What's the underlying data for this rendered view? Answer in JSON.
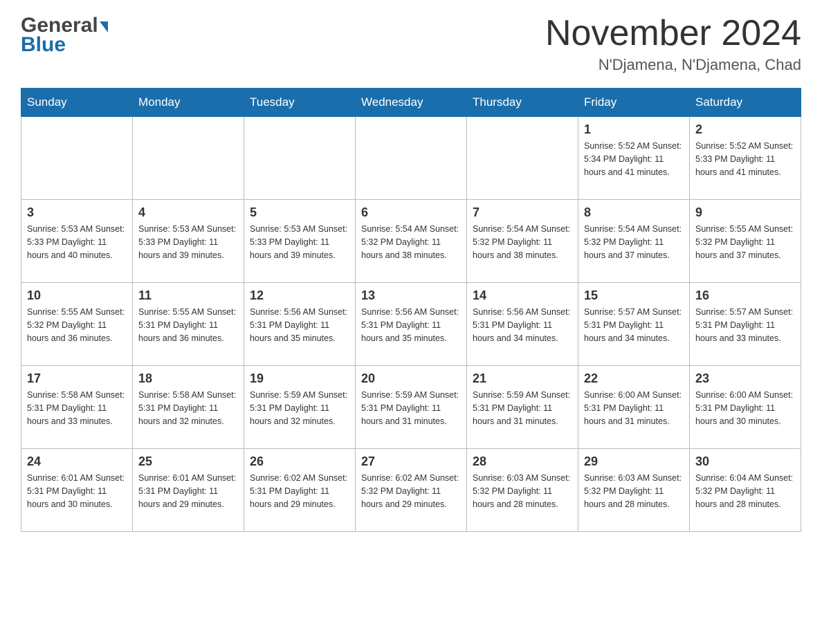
{
  "header": {
    "logo_general": "General",
    "logo_blue": "Blue",
    "month_title": "November 2024",
    "location": "N'Djamena, N'Djamena, Chad"
  },
  "calendar": {
    "days_of_week": [
      "Sunday",
      "Monday",
      "Tuesday",
      "Wednesday",
      "Thursday",
      "Friday",
      "Saturday"
    ],
    "weeks": [
      [
        {
          "day": "",
          "info": ""
        },
        {
          "day": "",
          "info": ""
        },
        {
          "day": "",
          "info": ""
        },
        {
          "day": "",
          "info": ""
        },
        {
          "day": "",
          "info": ""
        },
        {
          "day": "1",
          "info": "Sunrise: 5:52 AM\nSunset: 5:34 PM\nDaylight: 11 hours and 41 minutes."
        },
        {
          "day": "2",
          "info": "Sunrise: 5:52 AM\nSunset: 5:33 PM\nDaylight: 11 hours and 41 minutes."
        }
      ],
      [
        {
          "day": "3",
          "info": "Sunrise: 5:53 AM\nSunset: 5:33 PM\nDaylight: 11 hours and 40 minutes."
        },
        {
          "day": "4",
          "info": "Sunrise: 5:53 AM\nSunset: 5:33 PM\nDaylight: 11 hours and 39 minutes."
        },
        {
          "day": "5",
          "info": "Sunrise: 5:53 AM\nSunset: 5:33 PM\nDaylight: 11 hours and 39 minutes."
        },
        {
          "day": "6",
          "info": "Sunrise: 5:54 AM\nSunset: 5:32 PM\nDaylight: 11 hours and 38 minutes."
        },
        {
          "day": "7",
          "info": "Sunrise: 5:54 AM\nSunset: 5:32 PM\nDaylight: 11 hours and 38 minutes."
        },
        {
          "day": "8",
          "info": "Sunrise: 5:54 AM\nSunset: 5:32 PM\nDaylight: 11 hours and 37 minutes."
        },
        {
          "day": "9",
          "info": "Sunrise: 5:55 AM\nSunset: 5:32 PM\nDaylight: 11 hours and 37 minutes."
        }
      ],
      [
        {
          "day": "10",
          "info": "Sunrise: 5:55 AM\nSunset: 5:32 PM\nDaylight: 11 hours and 36 minutes."
        },
        {
          "day": "11",
          "info": "Sunrise: 5:55 AM\nSunset: 5:31 PM\nDaylight: 11 hours and 36 minutes."
        },
        {
          "day": "12",
          "info": "Sunrise: 5:56 AM\nSunset: 5:31 PM\nDaylight: 11 hours and 35 minutes."
        },
        {
          "day": "13",
          "info": "Sunrise: 5:56 AM\nSunset: 5:31 PM\nDaylight: 11 hours and 35 minutes."
        },
        {
          "day": "14",
          "info": "Sunrise: 5:56 AM\nSunset: 5:31 PM\nDaylight: 11 hours and 34 minutes."
        },
        {
          "day": "15",
          "info": "Sunrise: 5:57 AM\nSunset: 5:31 PM\nDaylight: 11 hours and 34 minutes."
        },
        {
          "day": "16",
          "info": "Sunrise: 5:57 AM\nSunset: 5:31 PM\nDaylight: 11 hours and 33 minutes."
        }
      ],
      [
        {
          "day": "17",
          "info": "Sunrise: 5:58 AM\nSunset: 5:31 PM\nDaylight: 11 hours and 33 minutes."
        },
        {
          "day": "18",
          "info": "Sunrise: 5:58 AM\nSunset: 5:31 PM\nDaylight: 11 hours and 32 minutes."
        },
        {
          "day": "19",
          "info": "Sunrise: 5:59 AM\nSunset: 5:31 PM\nDaylight: 11 hours and 32 minutes."
        },
        {
          "day": "20",
          "info": "Sunrise: 5:59 AM\nSunset: 5:31 PM\nDaylight: 11 hours and 31 minutes."
        },
        {
          "day": "21",
          "info": "Sunrise: 5:59 AM\nSunset: 5:31 PM\nDaylight: 11 hours and 31 minutes."
        },
        {
          "day": "22",
          "info": "Sunrise: 6:00 AM\nSunset: 5:31 PM\nDaylight: 11 hours and 31 minutes."
        },
        {
          "day": "23",
          "info": "Sunrise: 6:00 AM\nSunset: 5:31 PM\nDaylight: 11 hours and 30 minutes."
        }
      ],
      [
        {
          "day": "24",
          "info": "Sunrise: 6:01 AM\nSunset: 5:31 PM\nDaylight: 11 hours and 30 minutes."
        },
        {
          "day": "25",
          "info": "Sunrise: 6:01 AM\nSunset: 5:31 PM\nDaylight: 11 hours and 29 minutes."
        },
        {
          "day": "26",
          "info": "Sunrise: 6:02 AM\nSunset: 5:31 PM\nDaylight: 11 hours and 29 minutes."
        },
        {
          "day": "27",
          "info": "Sunrise: 6:02 AM\nSunset: 5:32 PM\nDaylight: 11 hours and 29 minutes."
        },
        {
          "day": "28",
          "info": "Sunrise: 6:03 AM\nSunset: 5:32 PM\nDaylight: 11 hours and 28 minutes."
        },
        {
          "day": "29",
          "info": "Sunrise: 6:03 AM\nSunset: 5:32 PM\nDaylight: 11 hours and 28 minutes."
        },
        {
          "day": "30",
          "info": "Sunrise: 6:04 AM\nSunset: 5:32 PM\nDaylight: 11 hours and 28 minutes."
        }
      ]
    ]
  }
}
